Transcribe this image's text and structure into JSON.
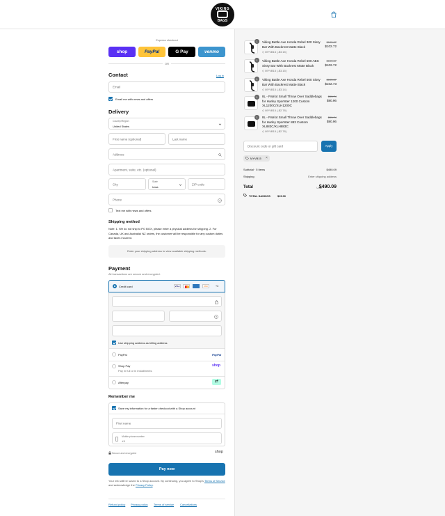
{
  "header": {
    "logo_top": "VIKING",
    "logo_bottom": "BAGS"
  },
  "express": {
    "title": "Express checkout",
    "buttons": [
      {
        "label": "shop",
        "color": "#5a31f4"
      },
      {
        "label": "PayPal",
        "color": "#ffc439"
      },
      {
        "label": "G Pay",
        "color": "#000000"
      },
      {
        "label": "venmo",
        "color": "#3d95ce"
      }
    ],
    "or": "OR"
  },
  "contact": {
    "title": "Contact",
    "login": "Log in",
    "email_placeholder": "Email",
    "email_news": "Email me with news and offers"
  },
  "delivery": {
    "title": "Delivery",
    "country_label": "Country/Region",
    "country": "United States",
    "first_name": "First name (optional)",
    "last_name": "Last name",
    "address": "Address",
    "apartment": "Apartment, suite, etc. (optional)",
    "city": "City",
    "state_label": "State",
    "state": "Iowa",
    "zip": "ZIP code",
    "phone": "Phone",
    "text_news": "Text me with news and offers"
  },
  "shipping": {
    "title": "Shipping method",
    "note": "Note: 1. We do not ship to PO BOX, please enter a physical address for shipping. 2. For Canada, UK and Australia/ NZ orders, the customer will be responsible for any custom duties and taxes incurred.",
    "placeholder": "Enter your shipping address to view available shipping methods."
  },
  "payment": {
    "title": "Payment",
    "subtitle": "All transactions are secure and encrypted.",
    "credit_card": "Credit card",
    "card_more": "+4",
    "billing_same": "Use shipping address as billing address",
    "paypal": "PayPal",
    "paypal_logo": "PayPal",
    "shoppay": "Shop Pay",
    "shoppay_sub": "Pay in full or in installments",
    "shoppay_logo": "shop",
    "afterpay": "Afterpay"
  },
  "remember": {
    "title": "Remember me",
    "save_info": "Save my information for a faster checkout with a Shop account",
    "first_name": "First name",
    "mobile_label": "Mobile phone number",
    "mobile_value": "+1",
    "secure": "Secure and encrypted",
    "shop_logo": "shop"
  },
  "pay_now": "Pay now",
  "legal": {
    "text": "Your info will be saved to a Shop account. By continuing, you agree to Shop's",
    "terms": "Terms of Service",
    "and": "and acknowledge the",
    "privacy": "Privacy Policy"
  },
  "footer_links": [
    "Refund policy",
    "Privacy policy",
    "Terms of service",
    "Cancellations"
  ],
  "order": {
    "items": [
      {
        "qty": "1",
        "name": "Viking Battle Axe Honda Rebel 300 Sissy Bar With Backrest Matte Black",
        "discount": "MYVB15 (-$3.15)",
        "old": "$105.87",
        "new": "$102.72"
      },
      {
        "qty": "1",
        "name": "Viking Battle Axe Honda Rebel 500 ABS Sissy Bar With Backrest Matte Black",
        "discount": "MYVB15 (-$3.15)",
        "old": "$105.87",
        "new": "$102.72"
      },
      {
        "qty": "1",
        "name": "Viking Battle Axe Honda Rebel 500 Sissy Bar With Backrest Matte Black",
        "discount": "MYVB15 (-$3.14)",
        "old": "$105.87",
        "new": "$102.73"
      },
      {
        "qty": "1",
        "name": "8L - Patriot Small Throw Over Saddlebags for Harley Sportster 1200 Custom XL1200C/XLH1200C",
        "discount": "MYVB15 (-$2.78)",
        "old": "$93.74",
        "new": "$90.96"
      },
      {
        "qty": "1",
        "name": "8L - Patriot Small Throw Over Saddlebags for Harley Sportster 883 Custom XL883C/XLH883C",
        "discount": "MYVB15 (-$2.78)",
        "old": "$93.74",
        "new": "$90.96"
      }
    ],
    "discount_placeholder": "Discount code or gift card",
    "apply": "Apply",
    "code": "MYVB15",
    "subtotal_label": "Subtotal · 5 items",
    "subtotal": "$490.09",
    "shipping_label": "Shipping",
    "shipping_value": "Enter shipping address",
    "total_label": "Total",
    "currency": "USD",
    "total": "$490.09",
    "savings_label": "TOTAL SAVINGS",
    "savings": "$15.00"
  },
  "colors": {
    "accent": "#1773b0",
    "pay_button": "#1773b0"
  }
}
